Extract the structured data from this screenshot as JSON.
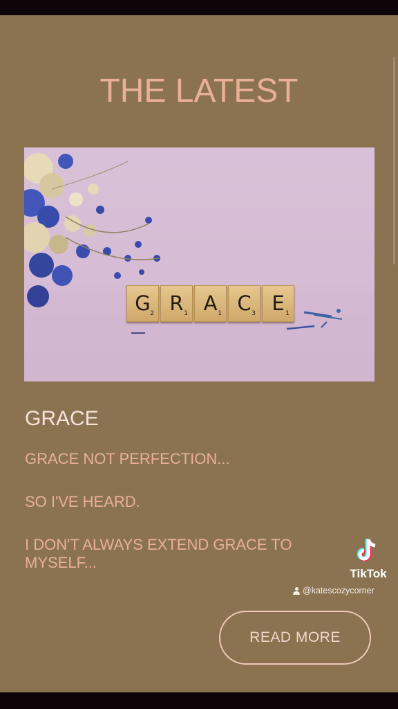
{
  "heading": "THE LATEST",
  "hero": {
    "tiles": [
      {
        "letter": "G",
        "score": "2"
      },
      {
        "letter": "R",
        "score": "1"
      },
      {
        "letter": "A",
        "score": "1"
      },
      {
        "letter": "C",
        "score": "3"
      },
      {
        "letter": "E",
        "score": "1"
      }
    ]
  },
  "post": {
    "title": "GRACE",
    "excerpt": [
      "GRACE NOT PERFECTION...",
      "SO I'VE HEARD.",
      "I DON'T ALWAYS EXTEND GRACE TO MYSELF..."
    ],
    "read_more_label": "READ MORE"
  },
  "watermark": {
    "brand": "TikTok",
    "handle": "@katescozycorner"
  },
  "colors": {
    "background": "#8b7352",
    "accent_peach": "#e9b095",
    "title_light": "#f5e4d8"
  }
}
